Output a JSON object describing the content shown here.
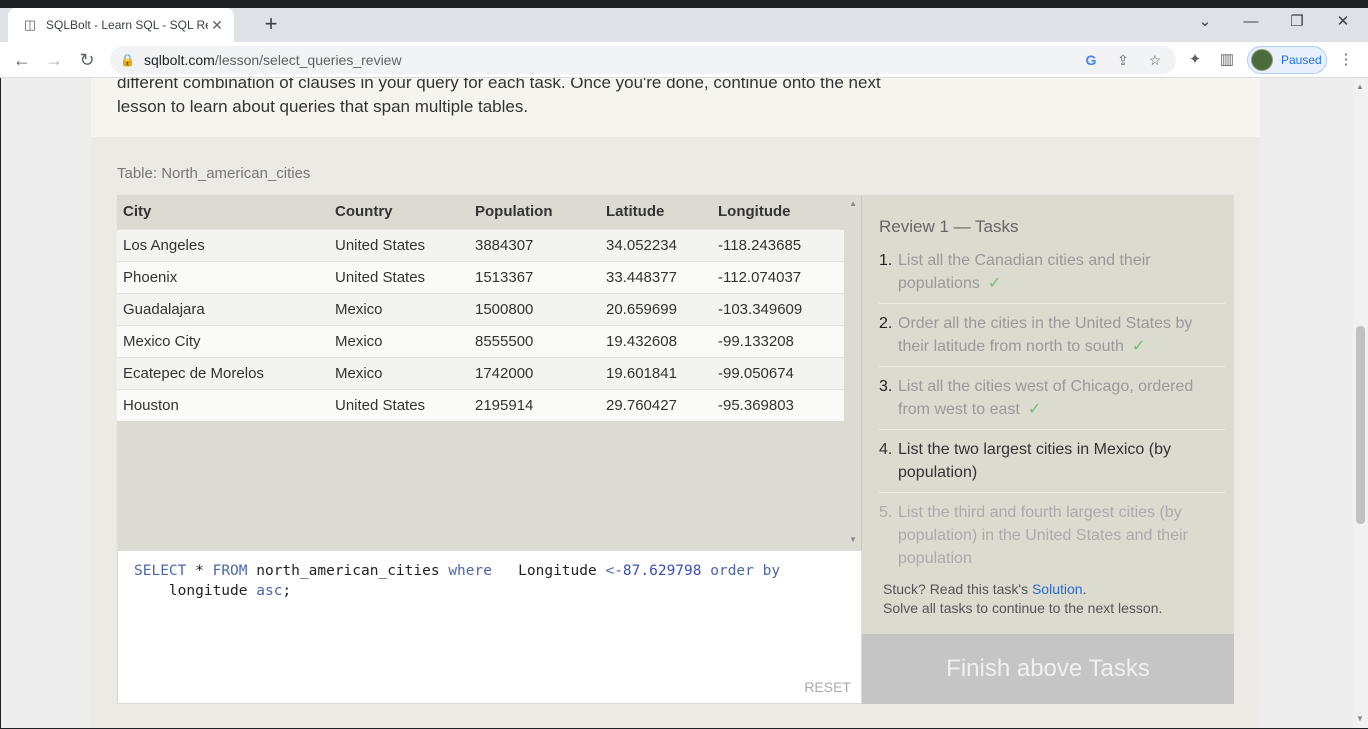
{
  "browser": {
    "tab_title": "SQLBolt - Learn SQL - SQL Review",
    "url_host": "sqlbolt.com",
    "url_path": "/lesson/select_queries_review",
    "profile_label": "Paused"
  },
  "intro": {
    "text": "different combination of clauses in your query for each task. Once you're done, continue onto the next lesson to learn about queries that span multiple tables."
  },
  "table": {
    "label": "Table: North_american_cities",
    "columns": [
      "City",
      "Country",
      "Population",
      "Latitude",
      "Longitude"
    ],
    "rows": [
      [
        "Los Angeles",
        "United States",
        "3884307",
        "34.052234",
        "-118.243685"
      ],
      [
        "Phoenix",
        "United States",
        "1513367",
        "33.448377",
        "-112.074037"
      ],
      [
        "Guadalajara",
        "Mexico",
        "1500800",
        "20.659699",
        "-103.349609"
      ],
      [
        "Mexico City",
        "Mexico",
        "8555500",
        "19.432608",
        "-99.133208"
      ],
      [
        "Ecatepec de Morelos",
        "Mexico",
        "1742000",
        "19.601841",
        "-99.050674"
      ],
      [
        "Houston",
        "United States",
        "2195914",
        "29.760427",
        "-95.369803"
      ]
    ]
  },
  "editor": {
    "line1": {
      "kw1": "SELECT",
      "star": " * ",
      "kw2": "FROM",
      "table": " north_american_cities ",
      "kw3": "where",
      "col": "   Longitude ",
      "op": "<",
      "num": "-87.629798",
      "kw4": " order by"
    },
    "line2": {
      "indent": "    ",
      "col": "longitude",
      "kw": " asc",
      "end": ";"
    },
    "reset_label": "RESET"
  },
  "tasks": {
    "title": "Review 1 — Tasks",
    "items": [
      {
        "n": "1.",
        "text": "List all the Canadian cities and their populations",
        "state": "done"
      },
      {
        "n": "2.",
        "text": "Order all the cities in the United States by their latitude from north to south",
        "state": "done"
      },
      {
        "n": "3.",
        "text": "List all the cities west of Chicago, ordered from west to east",
        "state": "done"
      },
      {
        "n": "4.",
        "text": "List the two largest cities in Mexico (by population)",
        "state": "current"
      },
      {
        "n": "5.",
        "text": "List the third and fourth largest cities (by population) in the United States and their population",
        "state": "todo"
      }
    ],
    "check_mark": "✓",
    "stuck_prefix": "Stuck? Read this task's ",
    "solution_link": "Solution",
    "stuck_suffix": ".",
    "continue_text": "Solve all tasks to continue to the next lesson.",
    "finish_button": "Finish above Tasks"
  }
}
